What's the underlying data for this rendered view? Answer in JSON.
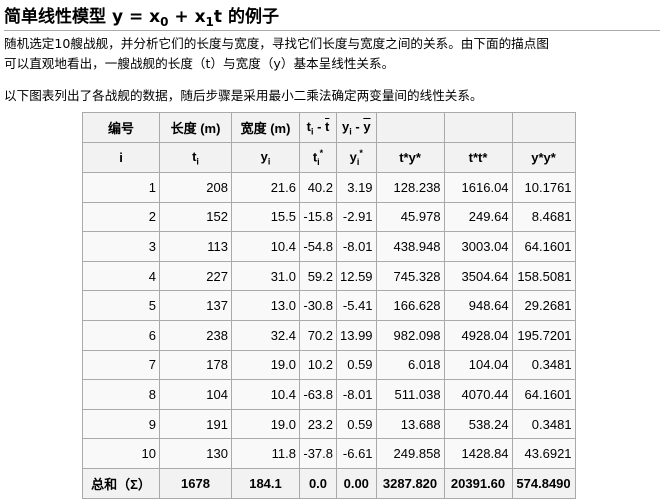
{
  "title": {
    "text": "简单线性模型",
    "eq_y": "y = x",
    "eq_sub0": "0",
    "eq_plus": " + x",
    "eq_sub1": "1",
    "eq_t": "t",
    "eq_suffix": " 的例子"
  },
  "paragraphs": {
    "p1": "随机选定10艘战舰，并分析它们的长度与宽度，寻找它们长度与宽度之间的关系。由下面的描点图",
    "p2": "可以直观地看出，一艘战舰的长度（t）与宽度（y）基本呈线性关系。",
    "p3": "以下图表列出了各战舰的数据，随后步骤是采用最小二乘法确定两变量间的线性关系。"
  },
  "table": {
    "header1": {
      "c0": "编号",
      "c1": "长度 (m)",
      "c2": "宽度 (m)",
      "c3_t": "t",
      "c3_sub": "i",
      "c3_rest": " - ",
      "c3_bar": "t",
      "c4_y": "y",
      "c4_sub": "i",
      "c4_rest": " - ",
      "c4_bar": "y"
    },
    "header2": {
      "c0": "i",
      "c1_base": "t",
      "c1_sub": "i",
      "c2_base": "y",
      "c2_sub": "i",
      "c3_base": "t",
      "c3_sub": "i",
      "c3_sup": "*",
      "c4_base": "y",
      "c4_sub": "i",
      "c4_sup": "*",
      "c5": "t*y*",
      "c6": "t*t*",
      "c7": "y*y*"
    },
    "rows": [
      [
        "1",
        "208",
        "21.6",
        "40.2",
        "3.19",
        "128.238",
        "1616.04",
        "10.1761"
      ],
      [
        "2",
        "152",
        "15.5",
        "-15.8",
        "-2.91",
        "45.978",
        "249.64",
        "8.4681"
      ],
      [
        "3",
        "113",
        "10.4",
        "-54.8",
        "-8.01",
        "438.948",
        "3003.04",
        "64.1601"
      ],
      [
        "4",
        "227",
        "31.0",
        "59.2",
        "12.59",
        "745.328",
        "3504.64",
        "158.5081"
      ],
      [
        "5",
        "137",
        "13.0",
        "-30.8",
        "-5.41",
        "166.628",
        "948.64",
        "29.2681"
      ],
      [
        "6",
        "238",
        "32.4",
        "70.2",
        "13.99",
        "982.098",
        "4928.04",
        "195.7201"
      ],
      [
        "7",
        "178",
        "19.0",
        "10.2",
        "0.59",
        "6.018",
        "104.04",
        "0.3481"
      ],
      [
        "8",
        "104",
        "10.4",
        "-63.8",
        "-8.01",
        "511.038",
        "4070.44",
        "64.1601"
      ],
      [
        "9",
        "191",
        "19.0",
        "23.2",
        "0.59",
        "13.688",
        "538.24",
        "0.3481"
      ],
      [
        "10",
        "130",
        "11.8",
        "-37.8",
        "-6.61",
        "249.858",
        "1428.84",
        "43.6921"
      ]
    ],
    "sum": [
      "总和（Σ）",
      "1678",
      "184.1",
      "0.0",
      "0.00",
      "3287.820",
      "20391.60",
      "574.8490"
    ]
  }
}
